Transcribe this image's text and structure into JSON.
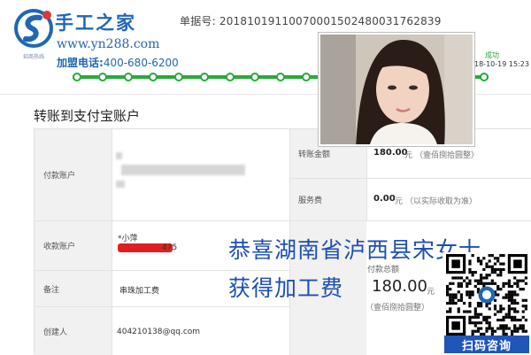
{
  "brand": {
    "name": "手工之家",
    "url": "www.yn288.com",
    "tagline": "招商热线",
    "phone_label": "加盟电话:",
    "phone": "400-680-6200"
  },
  "receipt": {
    "number_label": "单据号:",
    "number": "20181019110070001502480031762839",
    "status": "成功",
    "status_time": "18-10-19 15:23"
  },
  "colors": {
    "brand_blue": "#1f67b5",
    "progress_green": "#29a93a",
    "overlay_blue": "#1d4fb1",
    "qr_caption_bg": "#1f56b8"
  },
  "section": {
    "title": "转账到支付宝账户"
  },
  "details": {
    "payer_label": "付款账户",
    "payee_label": "收款账户",
    "payee_name": "*小萍",
    "payee_account_tail": "475",
    "remark_label": "备注",
    "remark_value": "串珠加工费",
    "creator_label": "创建人",
    "creator_value": "404210138@qq.com",
    "transfer_amount_label": "转账金额",
    "transfer_amount": "180.00",
    "transfer_amount_unit": "元",
    "transfer_amount_words": "（壹佰捌拾圆整）",
    "service_fee_label": "服务费",
    "service_fee": "0.00",
    "service_fee_unit": "元",
    "service_fee_note": "（以实际收取为准）",
    "total_label": "付款总额",
    "total_amount": "180.00",
    "total_unit": "元",
    "total_words": "（壹佰捌拾圆整）"
  },
  "overlay": {
    "line1": "恭喜湖南省泸西县宋女士",
    "line2": "获得加工费"
  },
  "qr": {
    "caption": "扫码咨询"
  },
  "progress": {
    "steps": 17
  }
}
